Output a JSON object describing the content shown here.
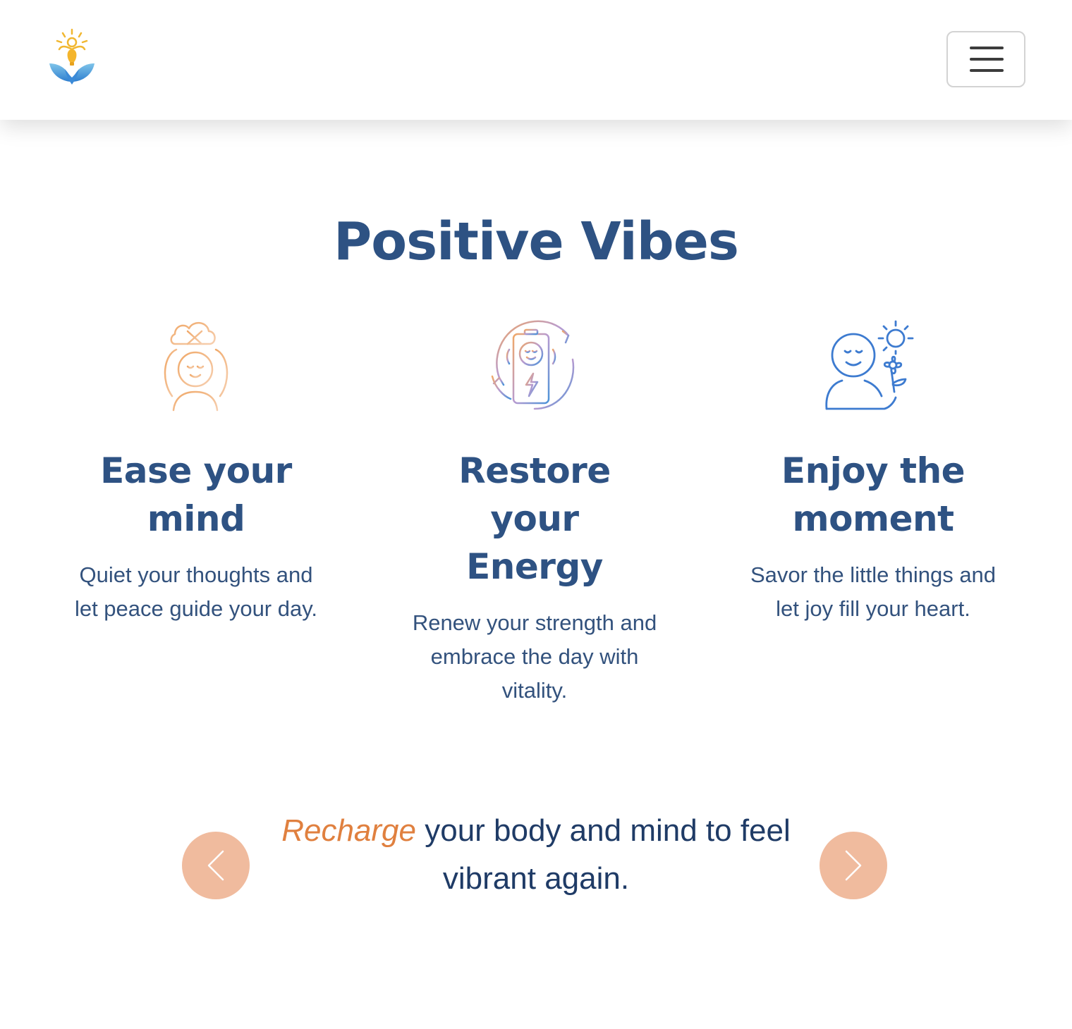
{
  "header": {
    "logo_icon": "lightbulb-lotus-logo-icon",
    "menu_icon": "hamburger-menu-icon"
  },
  "section": {
    "title": "Positive Vibes"
  },
  "features": [
    {
      "icon": "calm-mind-icon",
      "title": "Ease your mind",
      "text": "Quiet your thoughts and let peace guide your day."
    },
    {
      "icon": "battery-recharge-icon",
      "title": "Restore your Energy",
      "text": "Renew your strength and embrace the day with vitality."
    },
    {
      "icon": "person-sun-flower-icon",
      "title": "Enjoy the moment",
      "text": "Savor the little things and let joy fill your heart."
    }
  ],
  "carousel": {
    "highlight": "Recharge",
    "rest": " your body and mind to feel vibrant again.",
    "prev_icon": "chevron-left-icon",
    "next_icon": "chevron-right-icon"
  },
  "colors": {
    "heading": "#2e5283",
    "body_text": "#33527d",
    "quote_text": "#1f3b66",
    "highlight": "#e0803f",
    "arrow_bg": "#f0bb9e"
  }
}
